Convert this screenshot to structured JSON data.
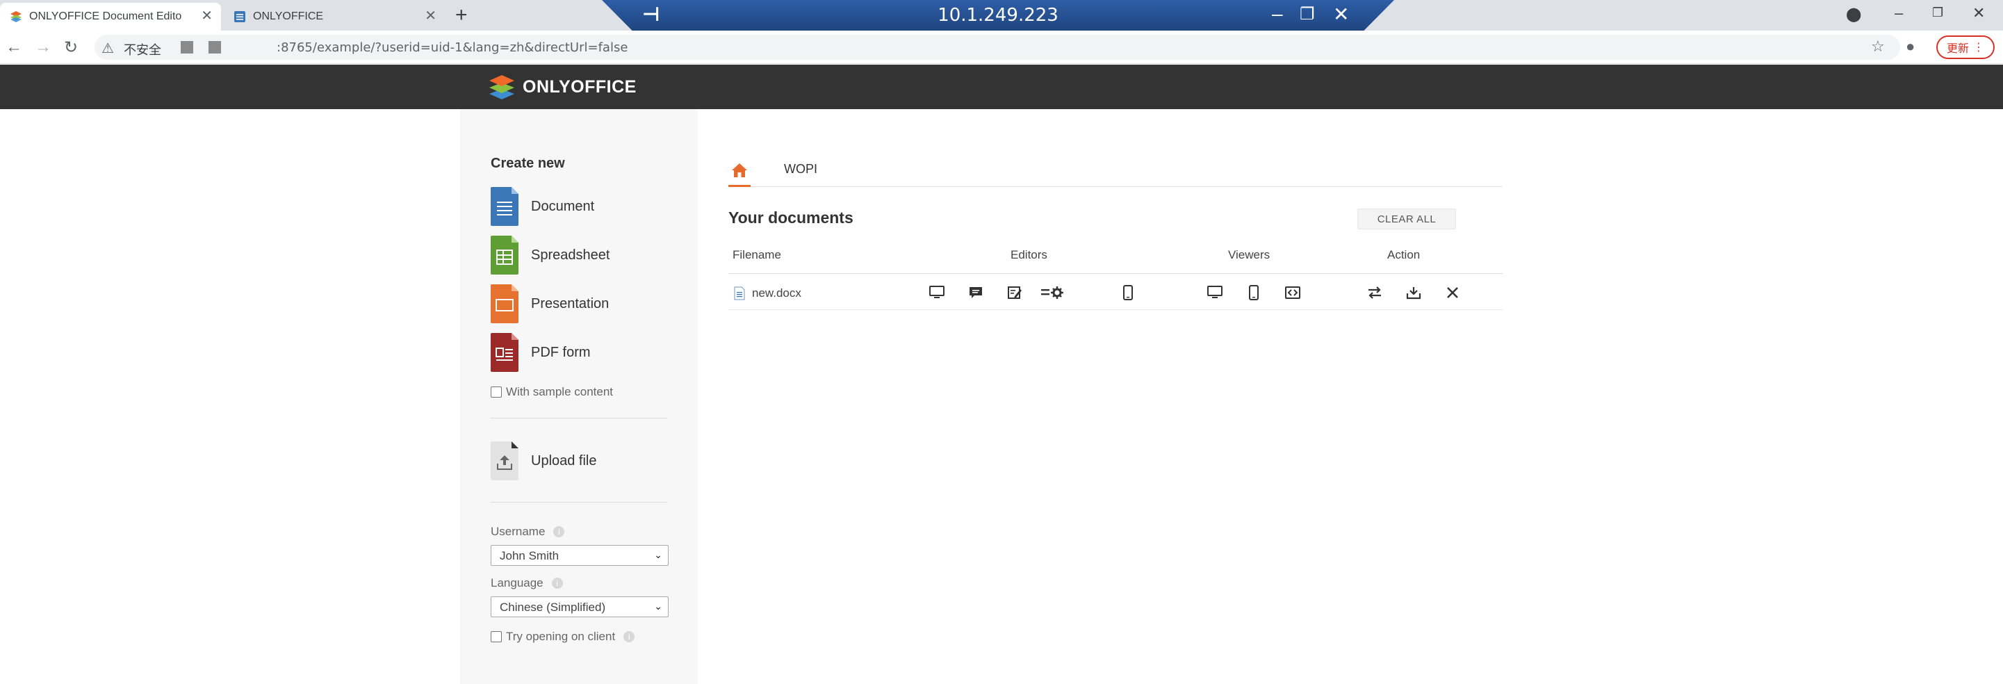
{
  "browser": {
    "tabs": [
      {
        "title": "ONLYOFFICE Document Edito",
        "active": true
      },
      {
        "title": "ONLYOFFICE",
        "active": false
      }
    ],
    "remote_session_title": "10.1.249.223",
    "address": {
      "security_label": "不安全",
      "url_visible": ":8765/example/?userid=uid-1&lang=zh&directUrl=false"
    },
    "update_button_label": "更新"
  },
  "header": {
    "brand": "ONLYOFFICE"
  },
  "sidebar": {
    "create_new_heading": "Create new",
    "create_items": [
      {
        "label": "Document",
        "icon": "document-icon",
        "color": "#3b77b6"
      },
      {
        "label": "Spreadsheet",
        "icon": "spreadsheet-icon",
        "color": "#5e9e34"
      },
      {
        "label": "Presentation",
        "icon": "presentation-icon",
        "color": "#e5722f"
      },
      {
        "label": "PDF form",
        "icon": "pdf-form-icon",
        "color": "#9b2a28"
      }
    ],
    "sample_content_label": "With sample content",
    "upload_label": "Upload file",
    "username_label": "Username",
    "username_value": "John Smith",
    "language_label": "Language",
    "language_value": "Chinese (Simplified)",
    "try_client_label": "Try opening on client"
  },
  "main": {
    "tabs": [
      {
        "label": "WOPI"
      }
    ],
    "your_documents_heading": "Your documents",
    "clear_all_label": "CLEAR ALL",
    "columns": {
      "filename": "Filename",
      "editors": "Editors",
      "viewers": "Viewers",
      "action": "Action"
    },
    "documents": [
      {
        "filename": "new.docx"
      }
    ]
  },
  "colors": {
    "header_bg": "#333333",
    "accent": "#e86a2c",
    "sidebar_bg": "#f7f7f8"
  }
}
